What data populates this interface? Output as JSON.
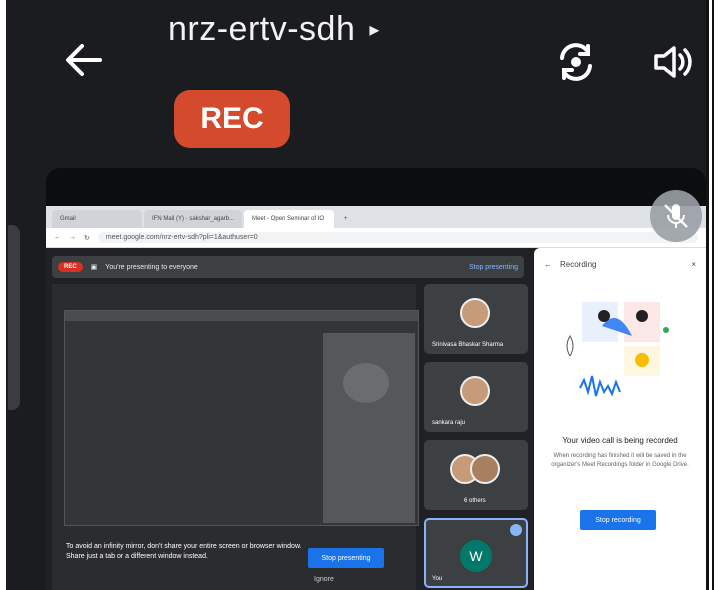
{
  "header": {
    "title": "nrz-ertv-sdh",
    "title_caret": "▸",
    "rec_badge": "REC",
    "back_icon": "back-arrow-icon",
    "switch_camera_icon": "switch-camera-icon",
    "speaker_icon": "speaker-icon"
  },
  "browser": {
    "tabs": [
      "Gmail",
      "IFN Mail (Y) · sakshar_agarb...",
      "Meet - Open Seminar of IO"
    ],
    "new_tab": "+",
    "url": "meet.google.com/nrz-ertv-sdh?pli=1&authuser=0"
  },
  "meet": {
    "rec_label": "REC",
    "presenting_text": "You're presenting to everyone",
    "stop_presenting_top": "Stop presenting",
    "warning_text": "To avoid an infinity mirror, don't share your entire screen or browser window. Share just a tab or a different window instead.",
    "stop_presenting_button": "Stop presenting",
    "ignore": "Ignore"
  },
  "participants": [
    {
      "name": "Srinivasa Bhaskar Sharma"
    },
    {
      "name": "sankara raju"
    },
    {
      "name": "6 others"
    },
    {
      "name": "You",
      "initial": "W"
    }
  ],
  "recording_panel": {
    "header": "Recording",
    "title": "Your video call is being recorded",
    "description": "When recording has finished it will be saved in the organizer's Meet Recordings folder in Google Drive.",
    "stop_button": "Stop recording"
  }
}
